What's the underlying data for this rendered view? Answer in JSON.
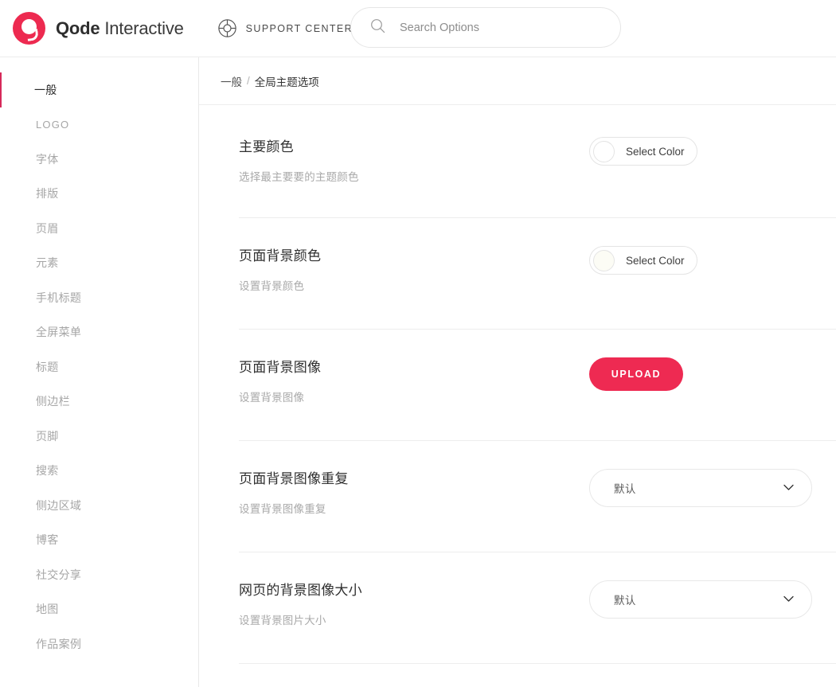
{
  "header": {
    "brand_bold": "Qode",
    "brand_light": "Interactive",
    "support_label": "SUPPORT CENTER",
    "support_icon": "lifering-icon",
    "search_placeholder": "Search Options",
    "search_value": "",
    "search_icon": "search-icon",
    "logo_icon": "qode-logo-icon",
    "accent_color": "#ED2A50"
  },
  "sidebar": {
    "active_index": 0,
    "active_marker_color": "#D6295A",
    "items": [
      {
        "label": "一般",
        "latin": false
      },
      {
        "label": "LOGO",
        "latin": true
      },
      {
        "label": "字体",
        "latin": false
      },
      {
        "label": "排版",
        "latin": false
      },
      {
        "label": "页眉",
        "latin": false
      },
      {
        "label": "元素",
        "latin": false
      },
      {
        "label": "手机标题",
        "latin": false
      },
      {
        "label": "全屏菜单",
        "latin": false
      },
      {
        "label": "标题",
        "latin": false
      },
      {
        "label": "侧边栏",
        "latin": false
      },
      {
        "label": "页脚",
        "latin": false
      },
      {
        "label": "搜索",
        "latin": false
      },
      {
        "label": "侧边区域",
        "latin": false
      },
      {
        "label": "博客",
        "latin": false
      },
      {
        "label": "社交分享",
        "latin": false
      },
      {
        "label": "地图",
        "latin": false
      },
      {
        "label": "作品案例",
        "latin": false
      }
    ]
  },
  "breadcrumb": {
    "parent": "一般",
    "separator": "/",
    "current": "全局主题选项"
  },
  "options": [
    {
      "title": "主要颜色",
      "desc": "选择最主要要的主题颜色",
      "control": "color",
      "button_label": "Select Color",
      "swatch_color": "#FFFFFF"
    },
    {
      "title": "页面背景颜色",
      "desc": "设置背景颜色",
      "control": "color",
      "button_label": "Select Color",
      "swatch_color": "#FCFCF5"
    },
    {
      "title": "页面背景图像",
      "desc": "设置背景图像",
      "control": "upload",
      "button_label": "UPLOAD"
    },
    {
      "title": "页面背景图像重复",
      "desc": "设置背景图像重复",
      "control": "select",
      "value": "默认"
    },
    {
      "title": "网页的背景图像大小",
      "desc": "设置背景图片大小",
      "control": "select",
      "value": "默认"
    }
  ]
}
